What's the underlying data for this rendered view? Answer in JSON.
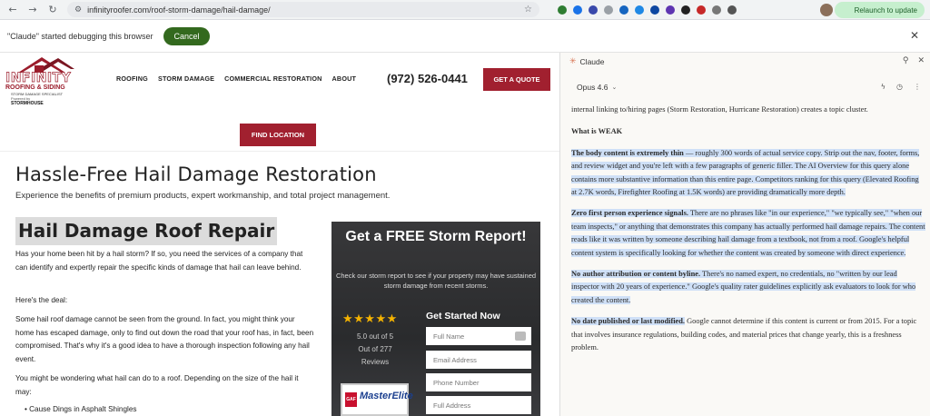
{
  "browser": {
    "url": "infinityroofer.com/roof-storm-damage/hail-damage/",
    "relaunch_label": "Relaunch to update",
    "debug_message": "\"Claude\" started debugging this browser",
    "cancel_label": "Cancel"
  },
  "site": {
    "logo": {
      "name": "INFINITY",
      "line2": "ROOFING & SIDING",
      "line3": "STORM DAMAGE SPECIALIST",
      "powered": "Powered by",
      "brand": "STORMHOUSE"
    },
    "nav": [
      "ROOFING",
      "STORM DAMAGE",
      "COMMERCIAL RESTORATION",
      "ABOUT"
    ],
    "phone": "(972) 526-0441",
    "quote_label": "GET A QUOTE",
    "find_location_label": "FIND LOCATION",
    "hero_title": "Hassle-Free Hail Damage Restoration",
    "hero_subtitle": "Experience the benefits of premium products, expert workmanship, and total project management.",
    "section_title": "Hail Damage Roof Repair",
    "paragraphs": [
      "Has your home been hit by a hail storm? If so, you need the services of a company that can identify and expertly repair the specific kinds of damage that hail can leave behind.",
      "Here's the deal:",
      "Some hail roof damage cannot be seen from the ground. In fact, you might think your home has escaped damage, only to find out down the road that your roof has, in fact, been compromised. That's why it's a good idea to have a thorough inspection following any hail event.",
      "You might be wondering what hail can do to a roof. Depending on the size of the hail it may:",
      "• Cause Dings in Asphalt Shingles"
    ],
    "storm_box": {
      "title": "Get a FREE Storm Report!",
      "description": "Check our storm report to see if your property may have sustained storm damage from recent storms.",
      "stars": "★★★★★",
      "rating_line1": "5.0 out of 5",
      "rating_line2": "Out of 277",
      "rating_line3": "Reviews",
      "badge_text": "MasterElite",
      "badge_gaf": "GAF",
      "form_title": "Get Started Now",
      "fields": [
        "Full Name",
        "Email Address",
        "Phone Number",
        "Full Address"
      ]
    }
  },
  "claude": {
    "title": "Claude",
    "model": "Opus 4.6",
    "intro": "internal linking to/hiring pages (Storm Restoration, Hurricane Restoration) creates a topic cluster.",
    "weak_heading": "What is WEAK",
    "points": [
      {
        "bold": "The body content is extremely thin",
        "text": " — roughly 300 words of actual service copy. Strip out the nav, footer, forms, and review widget and you're left with a few paragraphs of generic filler. The AI Overview for this query alone contains more substantive information than this entire page. Competitors ranking for this query (Elevated Roofing at 2.7K words, Firefighter Roofing at 1.5K words) are providing dramatically more depth."
      },
      {
        "bold": "Zero first person experience signals.",
        "text": " There are no phrases like \"in our experience,\" \"we typically see,\" \"when our team inspects,\" or anything that demonstrates this company has actually performed hail damage repairs. The content reads like it was written by someone describing hail damage from a textbook, not from a roof. Google's helpful content system is specifically looking for whether the content was created by someone with direct experience."
      },
      {
        "bold": "No author attribution or content byline.",
        "text": " There's no named expert, no credentials, no \"written by our lead inspector with 20 years of experience.\" Google's quality rater guidelines explicitly ask evaluators to look for who created the content."
      },
      {
        "bold": "No date published or last modified.",
        "text": " Google cannot determine if this content is current or from 2015. For a topic that involves insurance regulations, building codes, and material prices that change yearly, this is a freshness problem."
      }
    ]
  },
  "colors": {
    "brand_red": "#a1202f",
    "claude_orange": "#d97757",
    "highlight": "#cfe0f7",
    "relaunch_green": "#c6efce"
  }
}
